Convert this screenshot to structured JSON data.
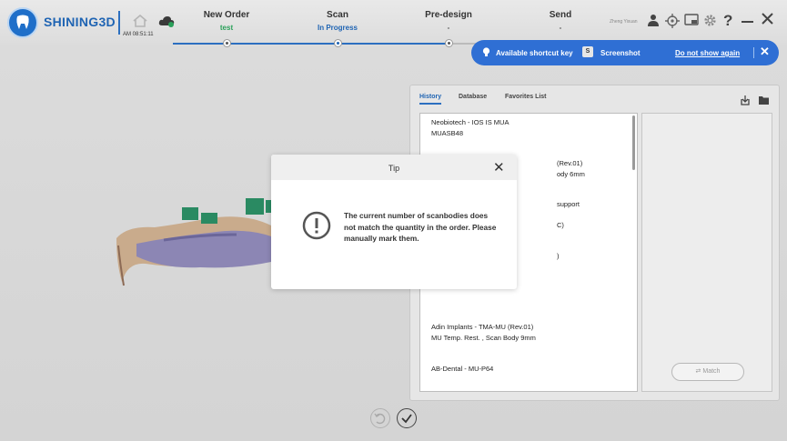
{
  "app": {
    "logo_text": "SHINING3D",
    "time": "AM 08:51:11",
    "user": "Zheng Yixuan"
  },
  "steps": [
    {
      "title": "New Order",
      "sub": "test",
      "sub_color": "#2aa05a"
    },
    {
      "title": "Scan",
      "sub": "In Progress",
      "sub_color": "#1f64b3"
    },
    {
      "title": "Pre-design",
      "sub": "-",
      "sub_color": "#555555"
    },
    {
      "title": "Send",
      "sub": "-",
      "sub_color": "#555555"
    }
  ],
  "banner": {
    "label": "Available shortcut key",
    "key": "S",
    "action": "Screenshot",
    "link": "Do not show again"
  },
  "panel": {
    "tabs": [
      "History",
      "Database",
      "Favorites List"
    ],
    "list": [
      [
        "Neobiotech - IOS IS MUA",
        "MUASB48"
      ],
      [
        "(Rev.01)",
        "ody 6mm"
      ],
      [
        "support"
      ],
      [
        "C)"
      ],
      [
        ")"
      ],
      [
        "Adin Implants - TMA-MU (Rev.01)",
        "MU Temp. Rest. , Scan Body 9mm"
      ],
      [
        "AB-Dental - MU-P64"
      ]
    ],
    "match_label": "Match"
  },
  "dialog": {
    "title": "Tip",
    "message": "The current number of scanbodies does not match the quantity in the order. Please manually mark them."
  },
  "colors": {
    "accent": "#2c6fc0",
    "banner": "#2f6fd4"
  },
  "icons": [
    "home-icon",
    "cloud-icon",
    "user-icon",
    "crosshair-icon",
    "screen-icon",
    "gear-icon",
    "help-icon",
    "minimize-icon",
    "close-icon",
    "bulb-icon",
    "import-icon",
    "folder-icon",
    "warning-icon",
    "undo-icon",
    "check-icon",
    "swap-icon"
  ]
}
